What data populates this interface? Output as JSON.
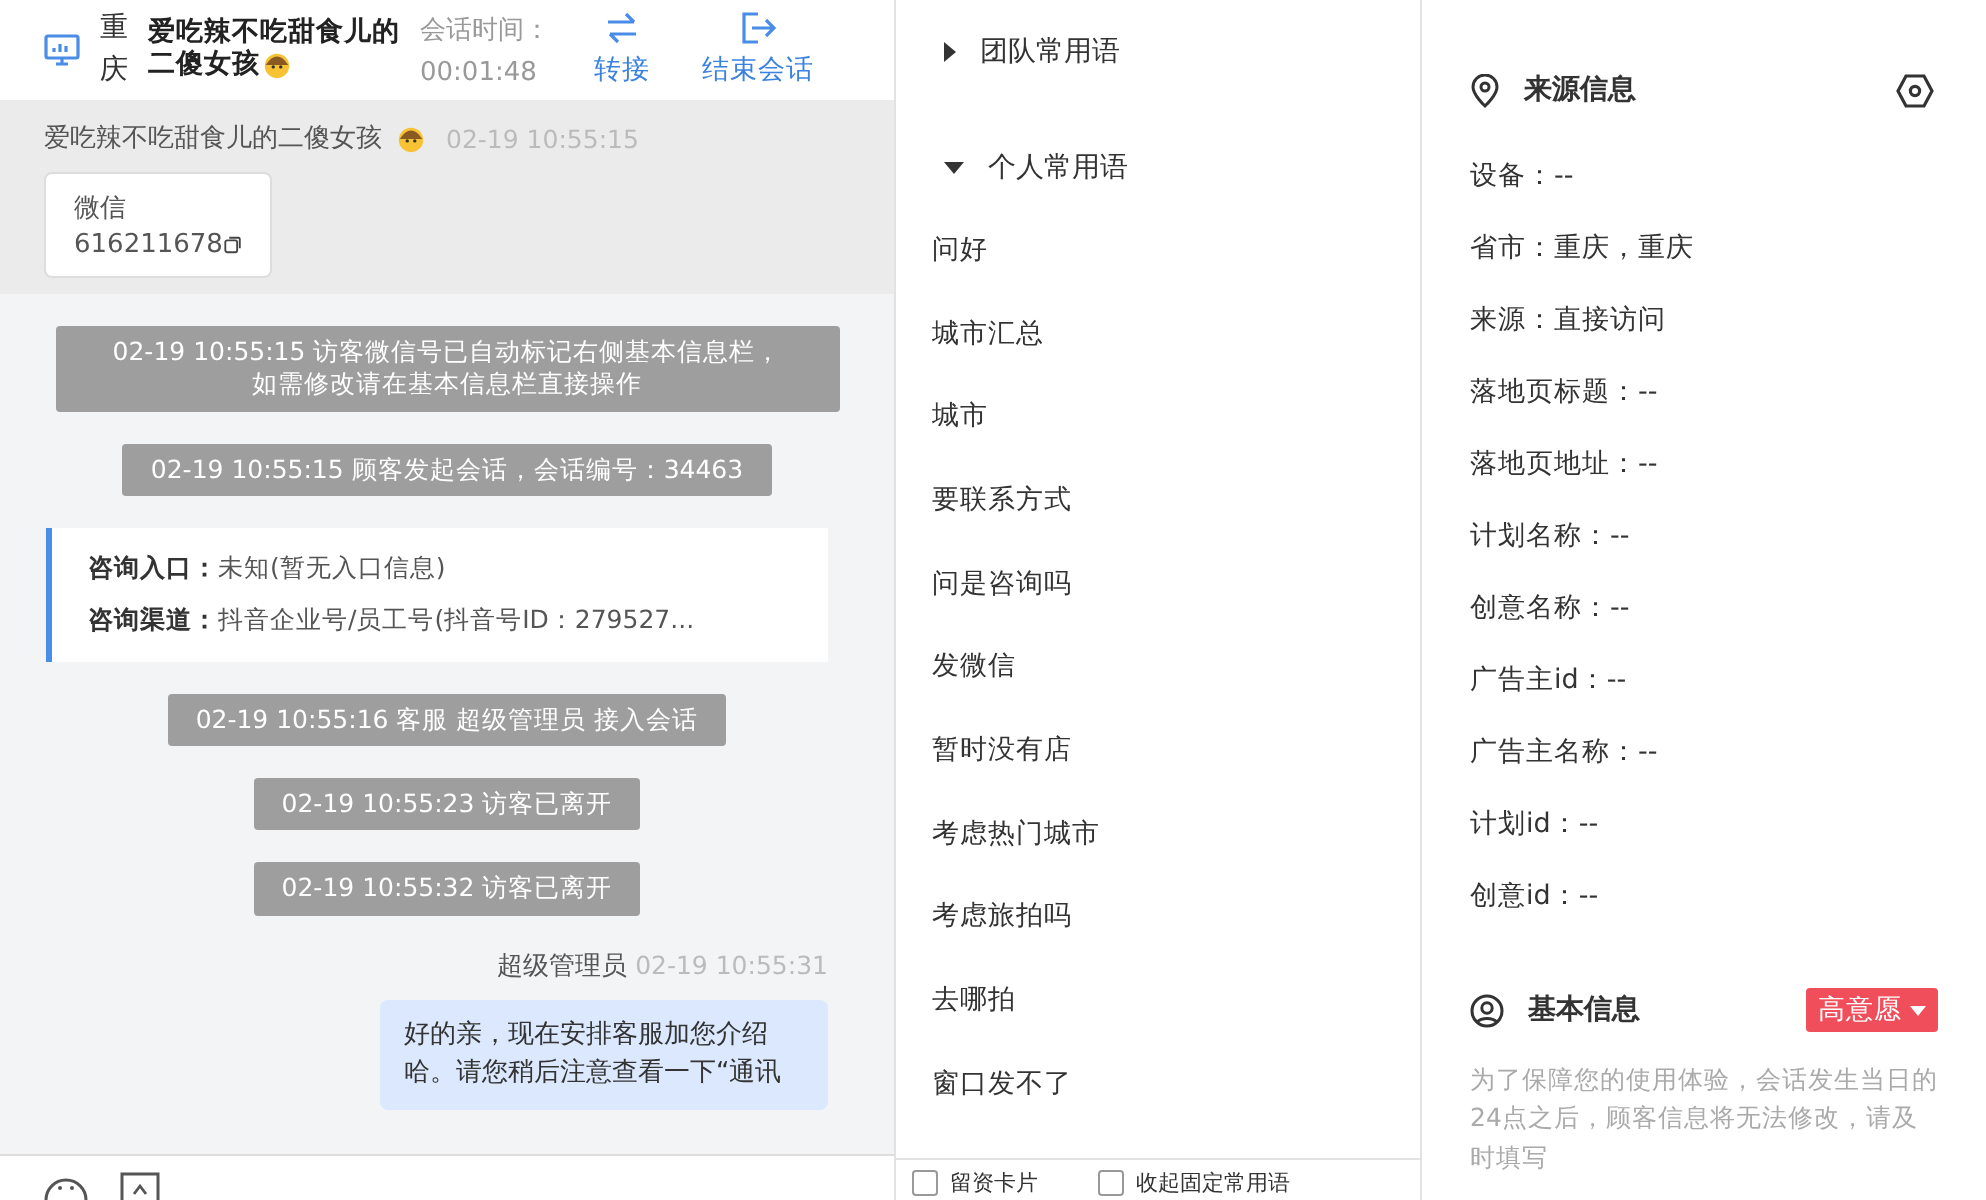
{
  "header": {
    "city": "重庆",
    "visitor_name": "爱吃辣不吃甜食儿的二傻女孩",
    "timer_label": "会话时间：",
    "timer_value": "00:01:48",
    "actions": [
      {
        "kind": "transfer",
        "label": "转接"
      },
      {
        "kind": "end",
        "label": "结束会话"
      }
    ]
  },
  "visitor_card": {
    "name": "爱吃辣不吃甜食儿的二傻女孩",
    "time": "02-19 10:55:15",
    "app": "微信",
    "account": "616211678"
  },
  "messages": [
    {
      "kind": "system",
      "lines": [
        "02-19 10:55:15 访客微信号已自动标记右侧基本信息栏，",
        "如需修改请在基本信息栏直接操作"
      ]
    },
    {
      "kind": "system",
      "lines": [
        "02-19 10:55:15 顾客发起会话，会话编号：34463"
      ]
    },
    {
      "kind": "info",
      "rows": [
        {
          "label": "咨询入口：",
          "value": "未知(暂无入口信息)"
        },
        {
          "label": "咨询渠道：",
          "value": "抖音企业号/员工号(抖音号ID：279527..."
        }
      ]
    },
    {
      "kind": "system",
      "lines": [
        "02-19 10:55:16 客服 超级管理员 接入会话"
      ]
    },
    {
      "kind": "system",
      "lines": [
        "02-19 10:55:23 访客已离开"
      ]
    },
    {
      "kind": "system",
      "lines": [
        "02-19 10:55:32 访客已离开"
      ]
    },
    {
      "kind": "agent",
      "sender": "超级管理员",
      "time": "02-19 10:55:31",
      "text": "好的亲，现在安排客服加您介绍哈。请您稍后注意查看一下“通讯"
    }
  ],
  "phrases": {
    "groups": [
      {
        "label": "团队常用语",
        "expanded": false
      },
      {
        "label": "个人常用语",
        "expanded": true,
        "items": [
          "问好",
          "城市汇总",
          "城市",
          "要联系方式",
          "问是咨询吗",
          "发微信",
          "暂时没有店",
          "考虑热门城市",
          "考虑旅拍吗",
          "去哪拍",
          "窗口发不了"
        ]
      }
    ],
    "options": [
      {
        "label": "留资卡片",
        "checked": false
      },
      {
        "label": "收起固定常用语",
        "checked": false
      }
    ]
  },
  "source_info": {
    "title": "来源信息",
    "fields": [
      "设备：--",
      "省市：重庆，重庆",
      "来源：直接访问",
      "落地页标题：--",
      "落地页地址：--",
      "计划名称：--",
      "创意名称：--",
      "广告主id：--",
      "广告主名称：--",
      "计划id：--",
      "创意id：--"
    ]
  },
  "basic_info": {
    "title": "基本信息",
    "intent": "高意愿",
    "notice": "为了保障您的使用体验，会话发生当日的24点之后，顾客信息将无法修改，请及时填写"
  }
}
